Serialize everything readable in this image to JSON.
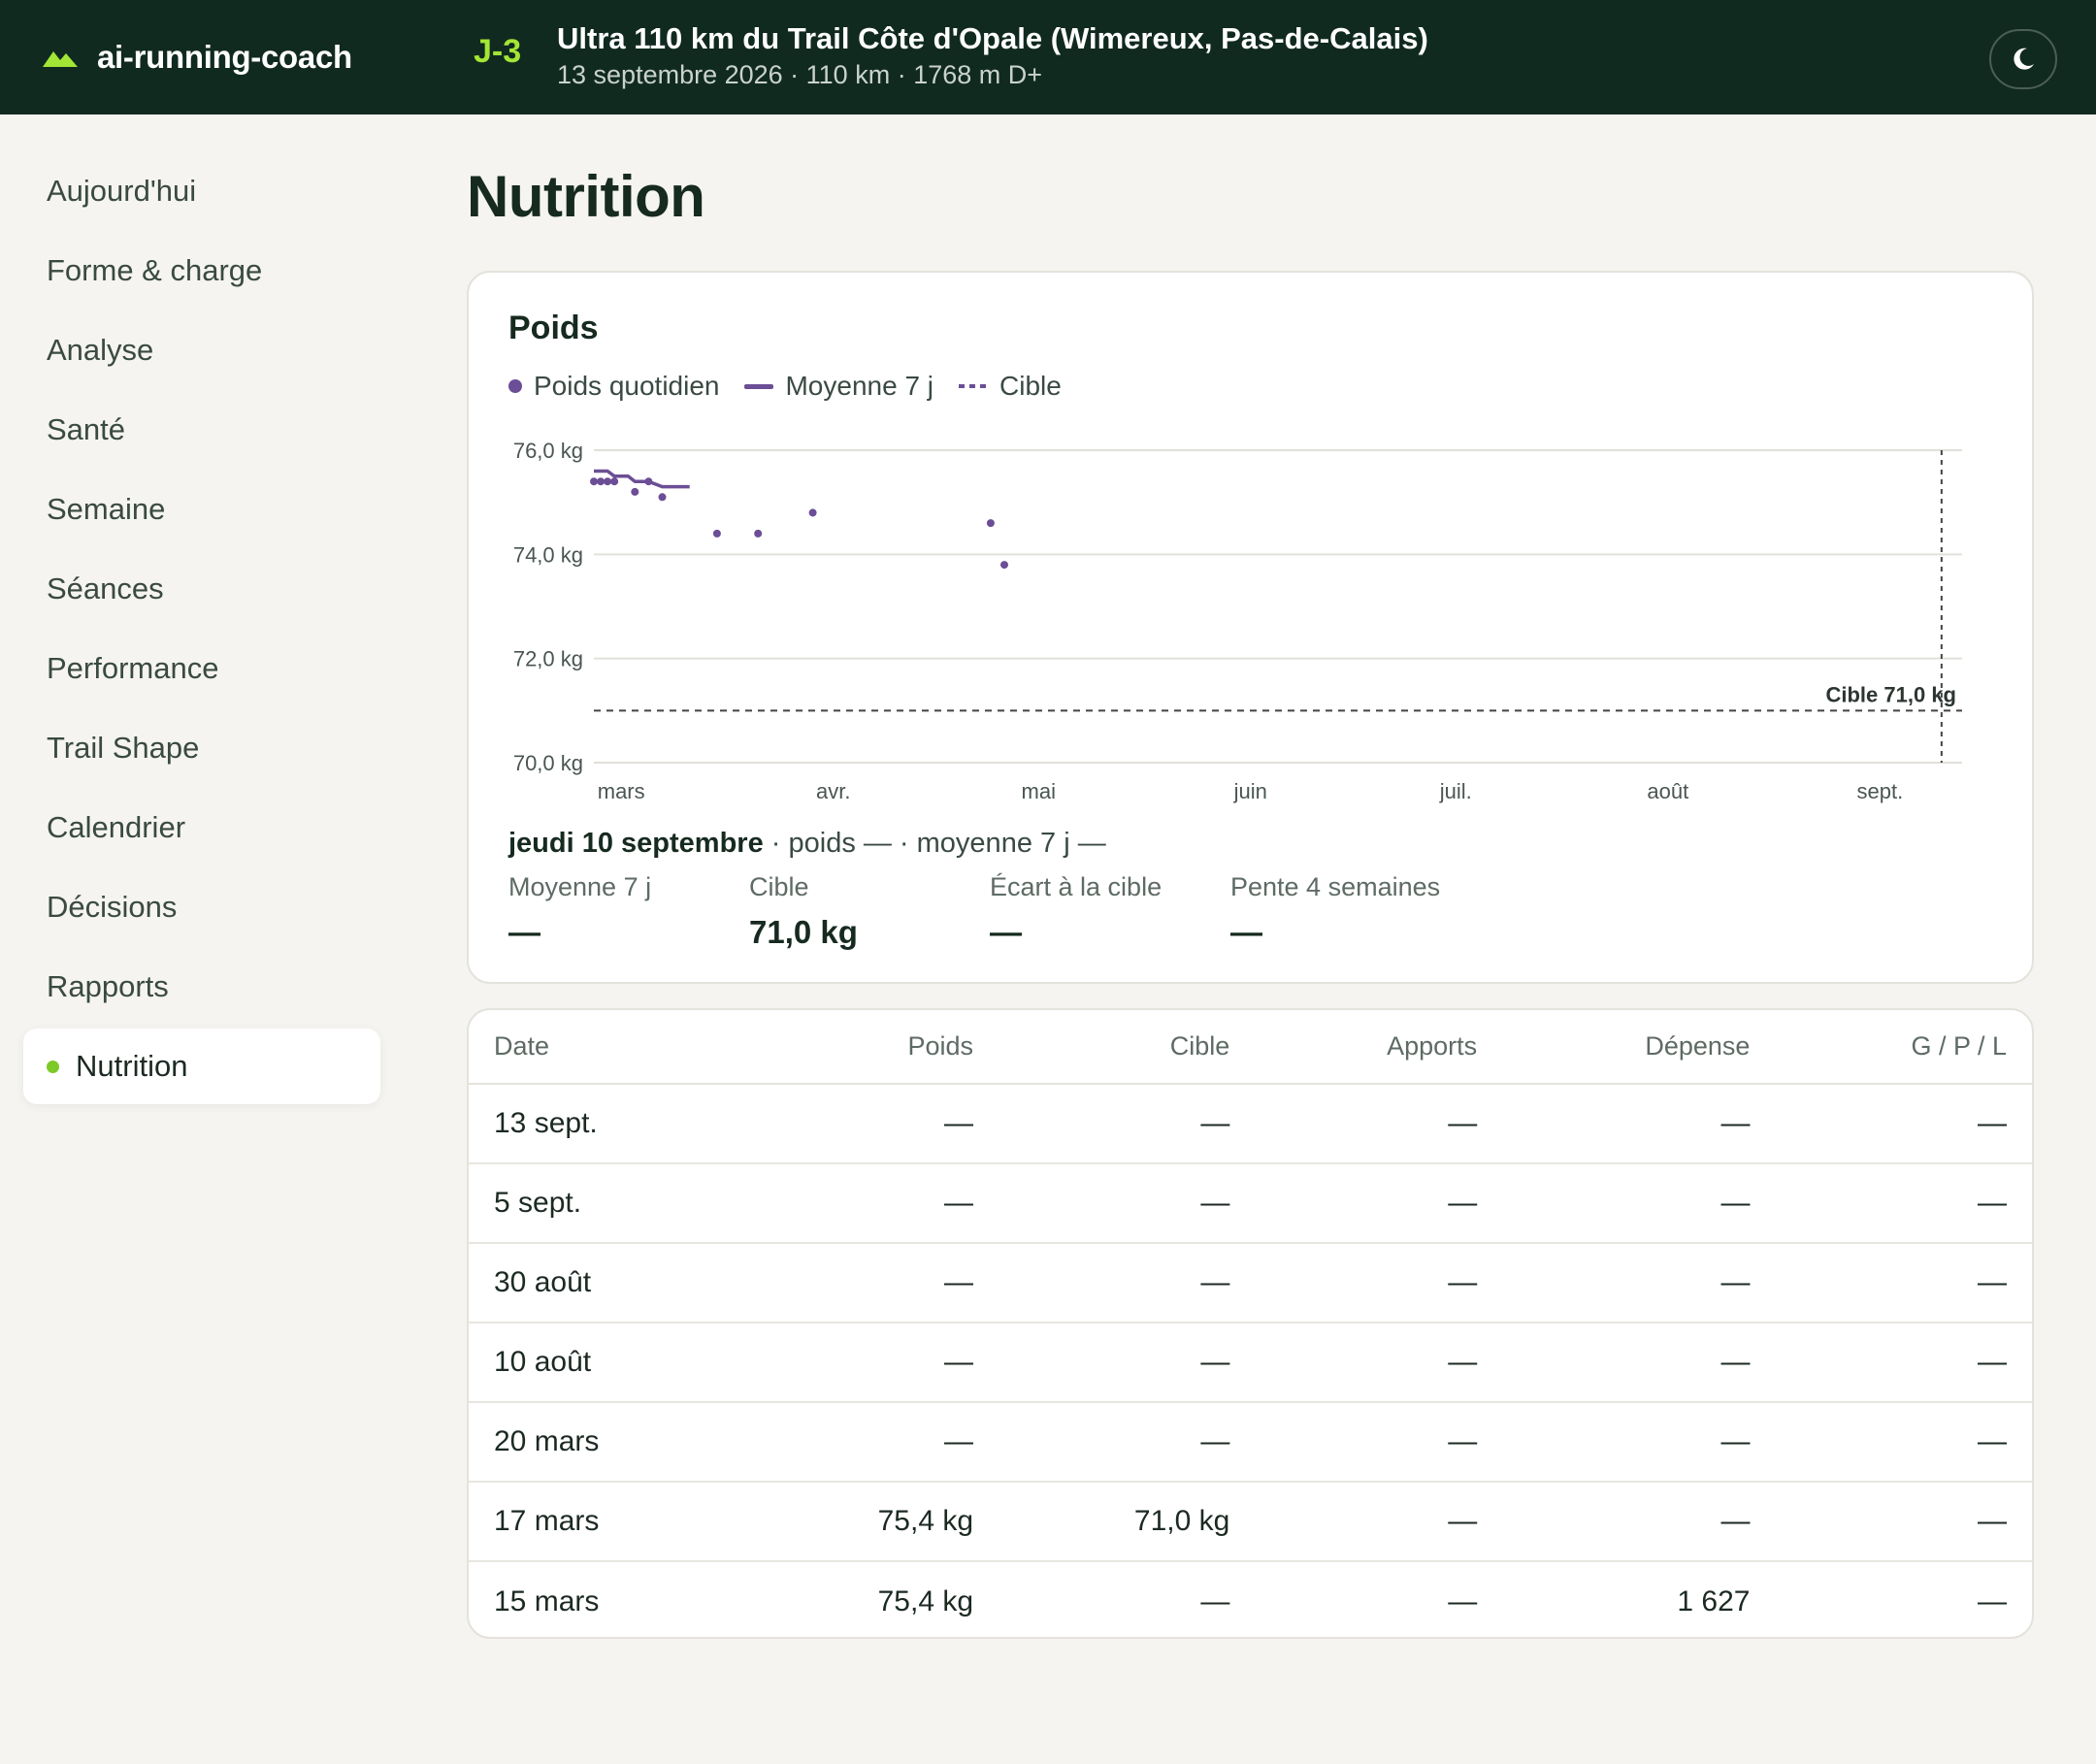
{
  "header": {
    "brand": "ai-running-coach",
    "countdown": "J-3",
    "race_title": "Ultra 110 km du Trail Côte d'Opale (Wimereux, Pas-de-Calais)",
    "race_meta": "13 septembre 2026 · 110 km · 1768 m D+",
    "accent_color": "#a3e635",
    "theme_icon": "moon-icon"
  },
  "sidebar": {
    "items": [
      {
        "label": "Aujourd'hui",
        "active": false
      },
      {
        "label": "Forme & charge",
        "active": false
      },
      {
        "label": "Analyse",
        "active": false
      },
      {
        "label": "Santé",
        "active": false
      },
      {
        "label": "Semaine",
        "active": false
      },
      {
        "label": "Séances",
        "active": false
      },
      {
        "label": "Performance",
        "active": false
      },
      {
        "label": "Trail Shape",
        "active": false
      },
      {
        "label": "Calendrier",
        "active": false
      },
      {
        "label": "Décisions",
        "active": false
      },
      {
        "label": "Rapports",
        "active": false
      },
      {
        "label": "Nutrition",
        "active": true
      }
    ]
  },
  "page": {
    "title": "Nutrition"
  },
  "weight_card": {
    "title": "Poids",
    "legend": {
      "daily": "Poids quotidien",
      "avg": "Moyenne 7 j",
      "target": "Cible"
    },
    "selected_day": {
      "day": "jeudi 10 septembre",
      "detail": " · poids — · moyenne 7 j —"
    },
    "stats": [
      {
        "label": "Moyenne 7 j",
        "value": "—"
      },
      {
        "label": "Cible",
        "value": "71,0 kg"
      },
      {
        "label": "Écart à la cible",
        "value": "—"
      },
      {
        "label": "Pente 4 semaines",
        "value": "—"
      }
    ]
  },
  "chart_data": {
    "type": "scatter",
    "title": "Poids",
    "y_ticks": [
      "70,0 kg",
      "72,0 kg",
      "74,0 kg",
      "76,0 kg"
    ],
    "ylim": [
      70,
      76
    ],
    "x_ticks": [
      {
        "label": "mars",
        "day": 0
      },
      {
        "label": "avr.",
        "day": 31
      },
      {
        "label": "mai",
        "day": 61
      },
      {
        "label": "juin",
        "day": 92
      },
      {
        "label": "juil.",
        "day": 122
      },
      {
        "label": "août",
        "day": 153
      },
      {
        "label": "sept.",
        "day": 184
      }
    ],
    "xlim": [
      "2026-02-25",
      "2026-09-13"
    ],
    "color": "#6b4e96",
    "series": [
      {
        "name": "Poids quotidien",
        "kind": "points",
        "points": [
          {
            "date": "2026-02-25",
            "y": 75.4
          },
          {
            "date": "2026-02-26",
            "y": 75.4
          },
          {
            "date": "2026-02-27",
            "y": 75.4
          },
          {
            "date": "2026-02-28",
            "y": 75.4
          },
          {
            "date": "2026-03-03",
            "y": 75.2
          },
          {
            "date": "2026-03-05",
            "y": 75.4
          },
          {
            "date": "2026-03-07",
            "y": 75.1
          },
          {
            "date": "2026-03-15",
            "y": 74.4
          },
          {
            "date": "2026-03-21",
            "y": 74.4
          },
          {
            "date": "2026-03-29",
            "y": 74.8
          },
          {
            "date": "2026-04-24",
            "y": 74.6
          },
          {
            "date": "2026-04-26",
            "y": 73.8
          }
        ]
      },
      {
        "name": "Moyenne 7 j",
        "kind": "line",
        "points": [
          {
            "date": "2026-02-25",
            "y": 75.6
          },
          {
            "date": "2026-02-27",
            "y": 75.6
          },
          {
            "date": "2026-02-28",
            "y": 75.5
          },
          {
            "date": "2026-03-02",
            "y": 75.5
          },
          {
            "date": "2026-03-03",
            "y": 75.4
          },
          {
            "date": "2026-03-05",
            "y": 75.4
          },
          {
            "date": "2026-03-07",
            "y": 75.3
          },
          {
            "date": "2026-03-11",
            "y": 75.3
          }
        ]
      },
      {
        "name": "Cible",
        "kind": "target",
        "value": 71.0,
        "label": "Cible 71,0 kg"
      }
    ],
    "selected_date": "2026-09-10"
  },
  "table": {
    "headers": [
      "Date",
      "Poids",
      "Cible",
      "Apports",
      "Dépense",
      "G / P / L"
    ],
    "rows": [
      [
        "13 sept.",
        "—",
        "—",
        "—",
        "—",
        "—"
      ],
      [
        "5 sept.",
        "—",
        "—",
        "—",
        "—",
        "—"
      ],
      [
        "30 août",
        "—",
        "—",
        "—",
        "—",
        "—"
      ],
      [
        "10 août",
        "—",
        "—",
        "—",
        "—",
        "—"
      ],
      [
        "20 mars",
        "—",
        "—",
        "—",
        "—",
        "—"
      ],
      [
        "17 mars",
        "75,4 kg",
        "71,0 kg",
        "—",
        "—",
        "—"
      ],
      [
        "15 mars",
        "75,4 kg",
        "—",
        "—",
        "1 627",
        "—"
      ]
    ]
  }
}
